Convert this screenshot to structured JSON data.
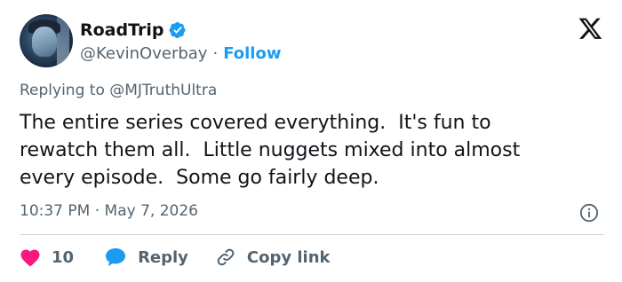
{
  "author": {
    "display_name": "RoadTrip",
    "handle": "@KevinOverbay",
    "separator": "·",
    "follow_label": "Follow"
  },
  "tweet": {
    "reply_prefix": "Replying to @MJTruthUltra",
    "text": "The entire series covered everything.  It's fun to\nrewatch them all.  Little nuggets mixed into almost\nevery episode.  Some go fairly deep.",
    "timestamp": "10:37 PM · May 7, 2026"
  },
  "actions": {
    "like_count": "10",
    "reply_label": "Reply",
    "copy_link_label": "Copy link"
  },
  "icons": {
    "verified": "verified-badge-icon",
    "brand": "x-logo-icon",
    "info": "info-icon",
    "like": "heart-icon",
    "reply": "speech-bubble-icon",
    "copy": "link-icon"
  },
  "colors": {
    "accent": "#1d9bf0",
    "like": "#f91880",
    "text": "#0f1419",
    "muted": "#536471"
  }
}
